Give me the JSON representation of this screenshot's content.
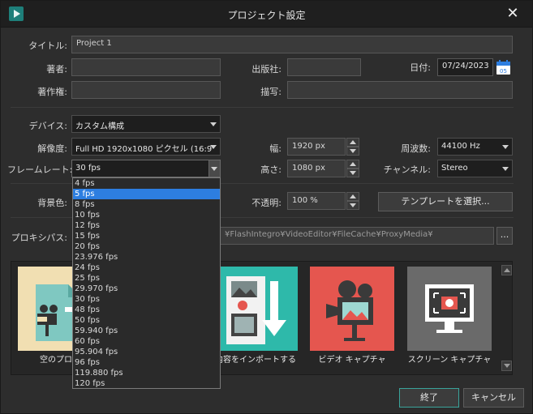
{
  "window": {
    "title": "プロジェクト設定"
  },
  "labels": {
    "title": "タイトル:",
    "author": "著者:",
    "publisher": "出版社:",
    "date": "日付:",
    "copyright": "著作権:",
    "description": "描写:",
    "device": "デバイス:",
    "resolution": "解像度:",
    "width": "幅:",
    "frequency": "周波数:",
    "framerate": "フレームレート:",
    "height": "高さ:",
    "channels": "チャンネル:",
    "background": "背景色:",
    "opacity": "不透明:",
    "proxy_path": "プロキシパス:"
  },
  "fields": {
    "title": "Project 1",
    "author": "",
    "publisher": "",
    "date": "07/24/2023",
    "copyright": "",
    "description": "",
    "device": "カスタム構成",
    "resolution": "Full HD 1920x1080 ピクセル (16:9",
    "width": "1920 px",
    "frequency": "44100 Hz",
    "framerate": "30 fps",
    "height": "1080 px",
    "channels": "Stereo",
    "opacity": "100 %",
    "proxy_path": "¥FlashIntegro¥VideoEditor¥FileCache¥ProxyMedia¥"
  },
  "calendar_day": "05",
  "buttons": {
    "template": "テンプレートを選択...",
    "browse": "...",
    "finish": "終了",
    "cancel": "キャンセル"
  },
  "templates": [
    {
      "label": "空のプロジ"
    },
    {
      "label": "内容をインポートする"
    },
    {
      "label": "ビデオ キャプチャ"
    },
    {
      "label": "スクリーン キャプチャ"
    }
  ],
  "framerate_options": [
    "4 fps",
    "5 fps",
    "8 fps",
    "10 fps",
    "12 fps",
    "15 fps",
    "20 fps",
    "23.976 fps",
    "24 fps",
    "25 fps",
    "29.970 fps",
    "30 fps",
    "48 fps",
    "50 fps",
    "59.940 fps",
    "60 fps",
    "95.904 fps",
    "96 fps",
    "119.880 fps",
    "120 fps"
  ],
  "framerate_highlighted": "5 fps",
  "colors": {
    "accent": "#3aa39b",
    "selection": "#2d7ee0",
    "tile_new": "#f1dfb2",
    "tile_import": "#2eb9aa",
    "tile_video": "#e5564f",
    "tile_screen": "#6a6a6a"
  }
}
